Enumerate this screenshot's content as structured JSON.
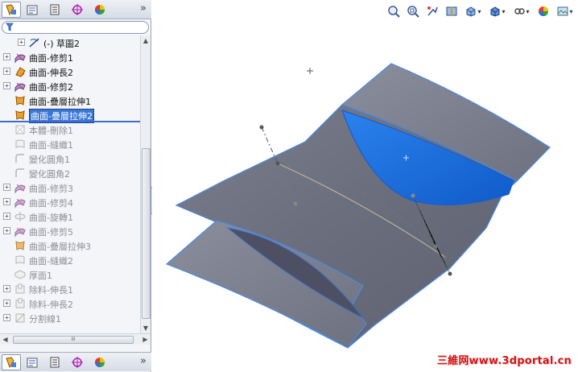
{
  "left_panel": {
    "top_tabs": [
      "feature-manager",
      "property-manager",
      "configuration-manager",
      "dim-xpert-manager",
      "display-manager"
    ],
    "more_label": "»",
    "filter_icon": "filter-icon",
    "tree": [
      {
        "label": "(-) 草圖2",
        "icon": "sketch-icon",
        "state": "normal",
        "indent": 2,
        "expand": "+"
      },
      {
        "label": "曲面-修剪1",
        "icon": "surface-trim-icon",
        "state": "normal",
        "indent": 1,
        "expand": "+"
      },
      {
        "label": "曲面-伸長2",
        "icon": "surface-extend-icon",
        "state": "normal",
        "indent": 1,
        "expand": "+"
      },
      {
        "label": "曲面-修剪2",
        "icon": "surface-trim-icon",
        "state": "normal",
        "indent": 1,
        "expand": "+"
      },
      {
        "label": "曲面-疊層拉伸1",
        "icon": "surface-loft-icon",
        "state": "normal",
        "indent": 1,
        "expand": ""
      },
      {
        "label": "曲面-疊層拉伸2",
        "icon": "surface-loft-icon",
        "state": "selected",
        "indent": 1,
        "expand": ""
      },
      {
        "label": "本體-刪除1",
        "icon": "delete-body-icon",
        "state": "suppressed",
        "indent": 1,
        "expand": ""
      },
      {
        "label": "曲面-縫織1",
        "icon": "surface-knit-icon",
        "state": "suppressed",
        "indent": 1,
        "expand": ""
      },
      {
        "label": "變化圓角1",
        "icon": "variable-fillet-icon",
        "state": "suppressed",
        "indent": 1,
        "expand": ""
      },
      {
        "label": "變化圓角2",
        "icon": "variable-fillet-icon",
        "state": "suppressed",
        "indent": 1,
        "expand": ""
      },
      {
        "label": "曲面-修剪3",
        "icon": "surface-trim-icon",
        "state": "suppressed",
        "indent": 1,
        "expand": "+"
      },
      {
        "label": "曲面-修剪4",
        "icon": "surface-trim-icon",
        "state": "suppressed",
        "indent": 1,
        "expand": "+"
      },
      {
        "label": "曲面-旋轉1",
        "icon": "surface-revolve-icon",
        "state": "suppressed",
        "indent": 1,
        "expand": "+"
      },
      {
        "label": "曲面-修剪5",
        "icon": "surface-trim-icon",
        "state": "suppressed",
        "indent": 1,
        "expand": "+"
      },
      {
        "label": "曲面-疊層拉伸3",
        "icon": "surface-loft-icon",
        "state": "suppressed",
        "indent": 1,
        "expand": ""
      },
      {
        "label": "曲面-縫織2",
        "icon": "surface-knit-icon",
        "state": "suppressed",
        "indent": 1,
        "expand": ""
      },
      {
        "label": "厚面1",
        "icon": "thicken-icon",
        "state": "suppressed",
        "indent": 1,
        "expand": ""
      },
      {
        "label": "除料-伸長1",
        "icon": "cut-extrude-icon",
        "state": "suppressed",
        "indent": 1,
        "expand": "+"
      },
      {
        "label": "除料-伸長2",
        "icon": "cut-extrude-icon",
        "state": "suppressed",
        "indent": 1,
        "expand": "+"
      },
      {
        "label": "分割線1",
        "icon": "split-line-icon",
        "state": "suppressed",
        "indent": 1,
        "expand": "+"
      }
    ],
    "hscroll_grip": "III"
  },
  "viewport": {
    "toolbar": [
      "zoom-to-fit-icon",
      "zoom-to-area-icon",
      "previous-view-icon",
      "section-view-icon",
      "view-orientation-icon",
      "display-style-icon",
      "hide-show-items-icon",
      "edit-appearance-icon",
      "apply-scene-icon"
    ],
    "watermark": "三維网www.3dportal.cn"
  },
  "colors": {
    "surface_grey": "#6f7281",
    "surface_edge": "#4a8be0",
    "selected_face": "#1f6fe0",
    "tree_selection": "#3a76d8",
    "watermark": "#d01818"
  }
}
